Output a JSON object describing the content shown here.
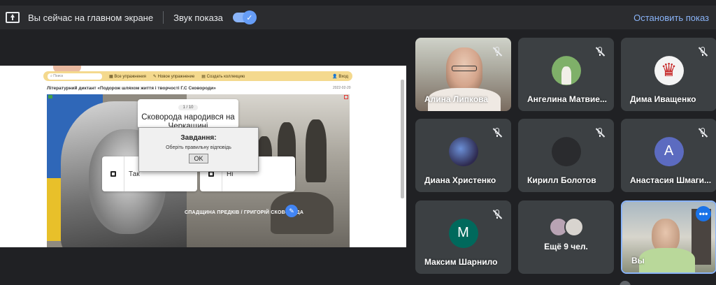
{
  "topbar": {
    "presenting_text": "Вы сейчас на главном экране",
    "audio_label": "Звук показа",
    "audio_on": true,
    "stop_label": "Остановить показ"
  },
  "shared_screen": {
    "toolbar": {
      "search_placeholder": "Поиск",
      "all_exercises": "Все упражнения",
      "new_exercise": "Новое упражнение",
      "create_collection": "Создать коллекцию",
      "login": "Вход"
    },
    "heading": "Літературний диктант «Подорож шляхом життя і творчості Г.С Сковороди»",
    "date": "2022-02-20",
    "question": {
      "counter": "1 / 10",
      "text": "Сковорода народився на Черкащині"
    },
    "answers": [
      {
        "label": "Так"
      },
      {
        "label": "Ні"
      }
    ],
    "dialog": {
      "title": "Завдання:",
      "message": "Оберіть правильну відповідь",
      "ok": "OK"
    },
    "caption": "СПАДЩИНА ПРЕДКІВ / ГРИГОРІЙ СКОВОРОДА"
  },
  "participants": [
    {
      "name": "Алина Липкова",
      "muted": true,
      "type": "video"
    },
    {
      "name": "Ангелина Матвие...",
      "muted": true,
      "type": "photo",
      "color": "#7fb069"
    },
    {
      "name": "Дима Иващенко",
      "muted": true,
      "type": "photo",
      "color": "#c62828"
    },
    {
      "name": "Диана Христенко",
      "muted": true,
      "type": "photo",
      "color": "#2e2a4f"
    },
    {
      "name": "Кирилл Болотов",
      "muted": true,
      "type": "blank",
      "color": "#303134"
    },
    {
      "name": "Анастасия Шмаги...",
      "muted": true,
      "type": "initial",
      "initial": "А",
      "color": "#5c6bc0"
    },
    {
      "name": "Максим Шарнило",
      "muted": true,
      "type": "initial",
      "initial": "М",
      "color": "#00695c"
    },
    {
      "name": "Вы",
      "muted": false,
      "type": "self"
    }
  ],
  "more_tile": {
    "label": "Ещё 9 чел."
  },
  "colors": {
    "accent": "#8ab4f8",
    "background": "#202124",
    "tile": "#3c4043"
  }
}
